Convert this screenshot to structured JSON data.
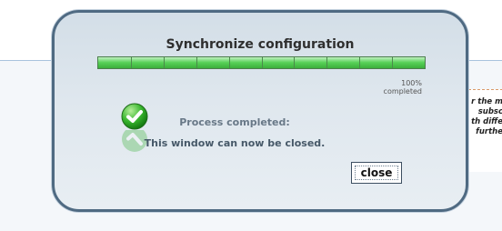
{
  "dialog": {
    "title": "Synchronize configuration",
    "progress": {
      "value": 100,
      "label_line1": "100%",
      "label_line2": "completed",
      "color": "#57d157"
    },
    "status": {
      "line1": "Process completed:",
      "line2": "This window can now be closed."
    },
    "close_button": "close"
  },
  "background": {
    "note_lines": [
      "r the m",
      "subsc",
      "th diffe",
      "furthe"
    ]
  },
  "icons": {
    "status_icon": "check-icon"
  }
}
